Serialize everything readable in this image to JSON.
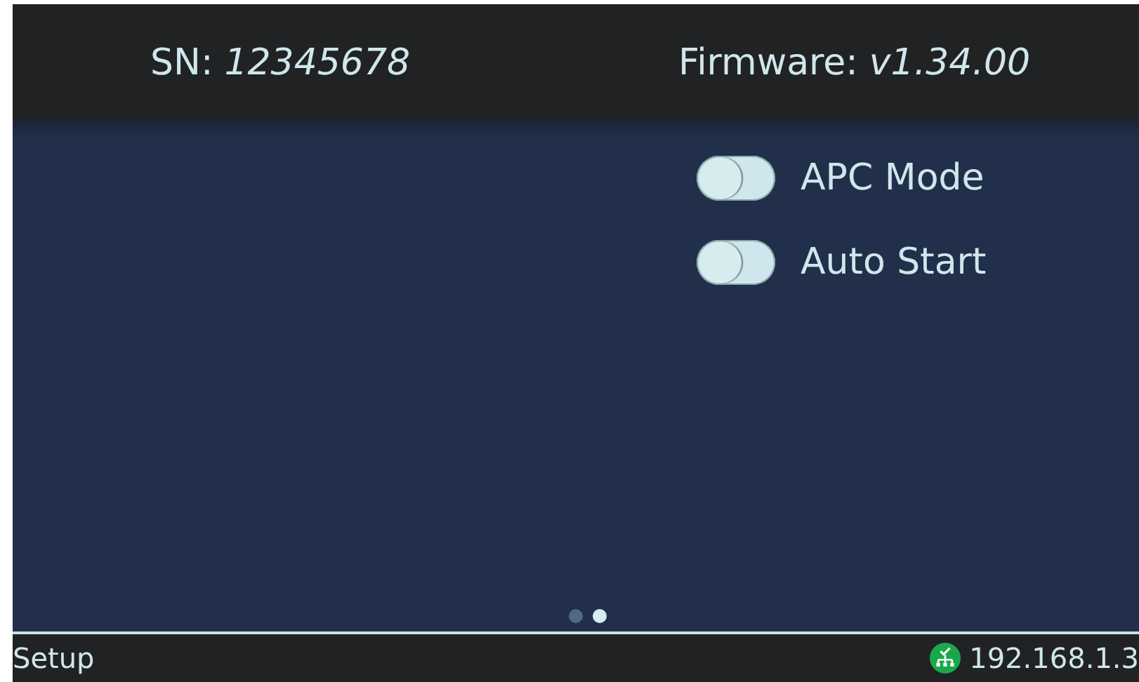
{
  "header": {
    "serial_label": "SN:",
    "serial": "12345678",
    "firmware_label": "Firmware:",
    "firmware": "v1.34.00"
  },
  "settings": [
    {
      "label": "APC Mode",
      "on": false
    },
    {
      "label": "Auto Start",
      "on": false
    }
  ],
  "pages": [
    {
      "selected": false
    },
    {
      "selected": true
    }
  ],
  "status_bar": {
    "screen": "Setup",
    "ip": "192.168.1.3"
  }
}
